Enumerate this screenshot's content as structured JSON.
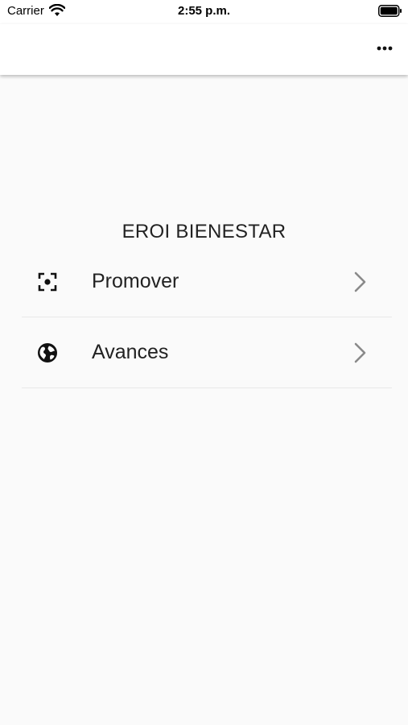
{
  "status_bar": {
    "carrier": "Carrier",
    "time": "2:55 p.m."
  },
  "app_bar": {
    "more_icon": "more-horizontal-icon"
  },
  "main": {
    "title": "EROI BIENESTAR",
    "items": [
      {
        "label": "Promover",
        "icon": "center-focus-icon"
      },
      {
        "label": "Avances",
        "icon": "globe-icon"
      }
    ]
  }
}
